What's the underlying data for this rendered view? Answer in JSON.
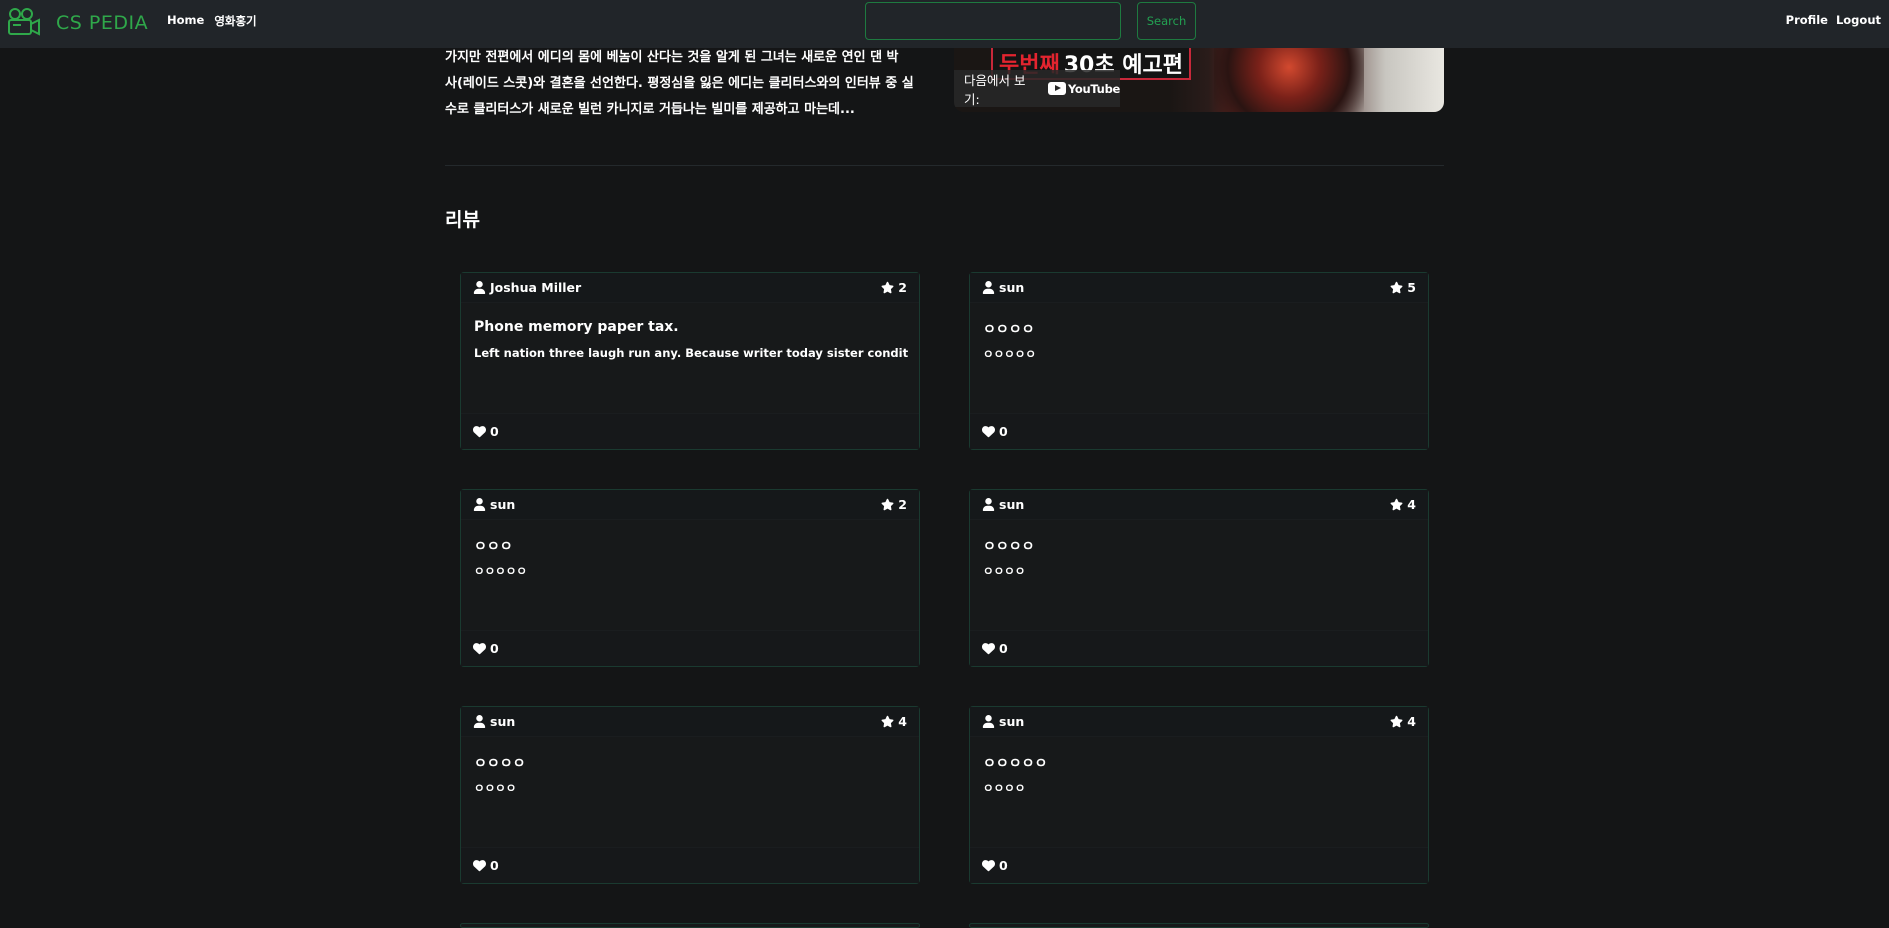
{
  "navbar": {
    "brand": "CS PEDIA",
    "links": [
      "Home",
      "영화홍기"
    ],
    "search_placeholder": "",
    "search_button": "Search",
    "right_links": [
      "Profile",
      "Logout"
    ],
    "brand_color": "#2fa84a",
    "accent_color": "#1e7a40"
  },
  "synopsis": "가지만 전편에서 에디의 몸에 베놈이 산다는 것을 알게 된 그녀는 새로운 연인 댄 박\n사(레이드 스콧)와 결혼을 선언한다. 평정심을 잃은 에디는 클리터스와의 인터뷰 중 실\n수로 클리터스가 새로운 빌런 카니지로 거듭나는 빌미를 제공하고 마는데...",
  "video": {
    "title_red": "두번째",
    "title_white": "30초 예고편",
    "watch_on": "다음에서 보기:",
    "youtube": "YouTube"
  },
  "reviews_title": "리뷰",
  "reviews": [
    {
      "author": "Joshua Miller",
      "rating": "2",
      "title": "Phone memory paper tax.",
      "body": "Left nation three laugh run any. Because writer today sister condition southe...",
      "likes": "0"
    },
    {
      "author": "sun",
      "rating": "5",
      "title": "ㅇㅇㅇㅇ",
      "body": "ㅇㅇㅇㅇㅇ",
      "likes": "0"
    },
    {
      "author": "sun",
      "rating": "2",
      "title": "ㅇㅇㅇ",
      "body": "ㅇㅇㅇㅇㅇ",
      "likes": "0"
    },
    {
      "author": "sun",
      "rating": "4",
      "title": "ㅇㅇㅇㅇ",
      "body": "ㅇㅇㅇㅇ",
      "likes": "0"
    },
    {
      "author": "sun",
      "rating": "4",
      "title": "ㅇㅇㅇㅇ",
      "body": "ㅇㅇㅇㅇ",
      "likes": "0"
    },
    {
      "author": "sun",
      "rating": "4",
      "title": "ㅇㅇㅇㅇㅇ",
      "body": "ㅇㅇㅇㅇ",
      "likes": "0"
    }
  ]
}
